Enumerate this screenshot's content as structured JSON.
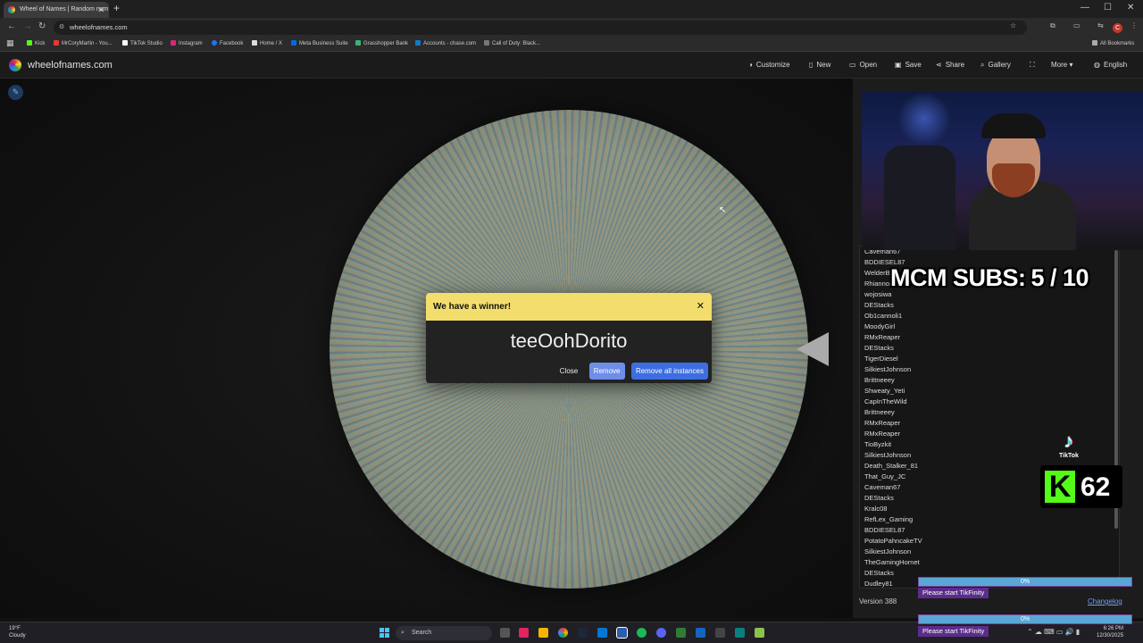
{
  "browser": {
    "tab_title": "Wheel of Names | Random nam",
    "url": "wheelofnames.com",
    "bookmarks": [
      "Kick",
      "MrCoryMartin - You...",
      "TikTok Studio",
      "Instagram",
      "Facebook",
      "Home / X",
      "Meta Business Suite",
      "Grasshopper Bank",
      "Accounts - chase.com",
      "Call of Duty: Black..."
    ],
    "all_bookmarks": "All Bookmarks",
    "profile_initial": "C"
  },
  "app": {
    "site_name": "wheelofnames.com",
    "menu": {
      "customize": "Customize",
      "new": "New",
      "open": "Open",
      "save": "Save",
      "share": "Share",
      "gallery": "Gallery",
      "more": "More",
      "language": "English"
    }
  },
  "dialog": {
    "title": "We have a winner!",
    "winner": "teeOohDorito",
    "close_label": "Close",
    "remove_label": "Remove",
    "remove_all_label": "Remove all instances"
  },
  "sidepanel": {
    "entries": [
      "Caveman67",
      "BDDIESEL87",
      "WelderBob",
      "Rhiannon",
      "wojosiwa",
      "DEStacks",
      "Ob1cannoli1",
      "MoodyGirl",
      "RMxReaper",
      "DEStacks",
      "TigerDiesel",
      "SilkiestJohnson",
      "Brittneeey",
      "Shweaty_Yeti",
      "CapInTheWild",
      "Brittneeey",
      "RMxReaper",
      "RMxReaper",
      "TioByzkit",
      "SilkiestJohnson",
      "Death_Stalker_81",
      "That_Guy_JC",
      "Caveman67",
      "DEStacks",
      "Kralc08",
      "RefLex_Gaming",
      "BDDIESEL87",
      "PotatoPahncakeTV",
      "SilkiestJohnson",
      "TheGamingHornet",
      "DEStacks",
      "Dudley81"
    ],
    "version": "Version 388",
    "changelog": "Changelog"
  },
  "overlays": {
    "subs_label": "MCM SUBS:",
    "subs_value": "5 / 10",
    "tiktok_label": "TikTok",
    "kick_count": "62",
    "tikfinity_pct": "0%",
    "tikfinity_message": "Please start TikFinity"
  },
  "taskbar": {
    "weather_temp": "19°F",
    "weather_desc": "Cloudy",
    "search_placeholder": "Search",
    "time": "6:26 PM",
    "date": "12/30/2025"
  },
  "colors": {
    "dialog_header": "#f3dd6d",
    "remove_button": "#6f8ee8",
    "remove_all_button": "#3d6ee0",
    "kick_green": "#53fc18"
  }
}
